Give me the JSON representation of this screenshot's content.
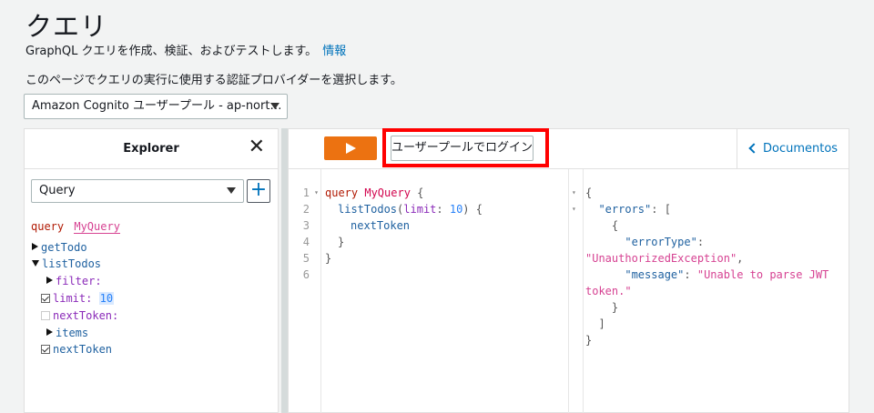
{
  "header": {
    "title": "クエリ",
    "subtitle": "GraphQL クエリを作成、検証、およびテストします。",
    "info_link": "情報",
    "auth_description": "このページでクエリの実行に使用する認証プロバイダーを選択します。",
    "auth_provider_selected": "Amazon Cognito ユーザープール - ap-nort…"
  },
  "explorer": {
    "title": "Explorer",
    "close_glyph": "✕",
    "operation_selected": "Query",
    "add_glyph": "+",
    "operation_keyword": "query",
    "operation_name": "MyQuery",
    "fields": {
      "get_todo": "getTodo",
      "list_todos": "listTodos",
      "filter": "filter:",
      "limit_label": "limit:",
      "limit_value": "10",
      "next_token_arg": "nextToken:",
      "items": "items",
      "next_token": "nextToken"
    }
  },
  "toolbar": {
    "run_icon": "play-icon",
    "login_button": "ユーザープールでログイン",
    "docs_link": "Documentos",
    "highlight_color": "#ff0000",
    "run_color": "#ec7211"
  },
  "query_editor": {
    "line_numbers": [
      "1",
      "2",
      "3",
      "4",
      "5",
      "6"
    ],
    "line1": {
      "keyword": "query",
      "name": "MyQuery",
      "brace": " {"
    },
    "line2": {
      "field": "listTodos",
      "open": "(",
      "arg": "limit",
      "colon": ": ",
      "value": "10",
      "close": ") {"
    },
    "line3": {
      "field": "nextToken"
    },
    "line4": {
      "text": "}"
    },
    "line5": {
      "text": "}"
    }
  },
  "result": {
    "l1": "{",
    "l2_key": "\"errors\"",
    "l2_rest": ": [",
    "l3": "{",
    "l4_key": "\"errorType\"",
    "l4_rest": ":",
    "l5_str": "\"UnauthorizedException\"",
    "l5_rest": ",",
    "l6_key": "\"message\"",
    "l6_rest": ": ",
    "l6_str": "\"Unable to parse JWT",
    "l7_str": "token.\"",
    "l8": "}",
    "l9": "]",
    "l10": "}"
  }
}
